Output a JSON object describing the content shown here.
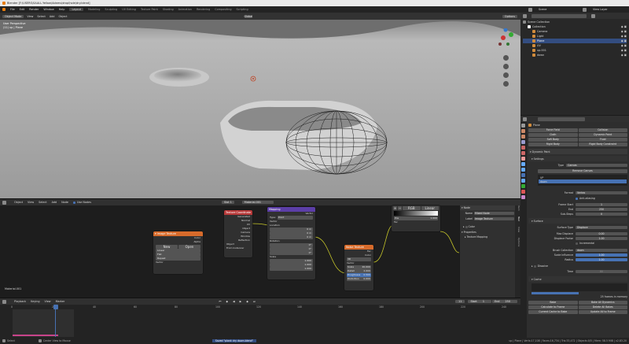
{
  "titlebar": {
    "title": "Blender [F:\\USERS\\SAALL.Yellow\\Adams\\drop\\hole\\dry.blend]"
  },
  "topbar": {
    "menus": [
      "File",
      "Edit",
      "Render",
      "Window",
      "Help"
    ],
    "workspaces": [
      "Layout",
      "Modeling",
      "Sculpting",
      "UV Editing",
      "Texture Paint",
      "Shading",
      "Animation",
      "Rendering",
      "Compositing",
      "Scripting"
    ],
    "scene": "Scene",
    "view_layer": "View Layer"
  },
  "viewport": {
    "mode": "Object Mode",
    "menus": [
      "View",
      "Select",
      "Add",
      "Object"
    ],
    "orientation": "Global",
    "options": "Options",
    "info_line1": "User Perspective",
    "info_line2": "(11) up | Plane"
  },
  "outliner": {
    "title": "Scene Collection",
    "items": [
      {
        "name": "Collection",
        "icon": "collection-icon"
      },
      {
        "name": "Camera",
        "icon": "camera-icon"
      },
      {
        "name": "Light",
        "icon": "light-icon"
      },
      {
        "name": "Plane",
        "icon": "mesh-icon"
      },
      {
        "name": "UV",
        "icon": "mesh-icon"
      },
      {
        "name": "up.001",
        "icon": "mesh-icon"
      },
      {
        "name": "down",
        "icon": "mesh-icon"
      }
    ]
  },
  "physics": {
    "object": "Plane",
    "buttons": [
      "Force Field",
      "Collision",
      "Cloth",
      "Dynamic Paint",
      "Soft Body",
      "Fluid",
      "Rigid Body",
      "Rigid Body Constraint"
    ],
    "dynamic_paint": "Dynamic Paint",
    "settings": "Settings",
    "type_label": "Type",
    "type_value": "Canvas",
    "remove_canvas": "Remove Canvas",
    "surfaces": [
      "UP",
      "down"
    ],
    "format_label": "Format",
    "format_value": "Vertex",
    "anti_aliasing": "Anti-aliasing",
    "frame_start_label": "Frame Start",
    "frame_start": "1",
    "end_label": "End",
    "end": "250",
    "substeps_label": "Sub-Steps",
    "substeps": "0",
    "surface": "Surface",
    "surface_type_label": "Surface Type",
    "surface_type": "Displace",
    "max_disp_label": "Max Displace",
    "max_disp": "0.00",
    "disp_factor_label": "Displace Factor",
    "disp_factor": "1.00",
    "incremental": "Incremental",
    "brush_coll_label": "Brush Collection",
    "brush_coll": "down",
    "scale_influence_label": "Scale Influence",
    "scale_influence": "1.00",
    "radius_label": "Radius",
    "radius": "1.00",
    "dissolve": "Dissolve",
    "time_label": "Time",
    "time": "80",
    "cache": "Cache",
    "cache_info": "25 frames in memory",
    "bake_buttons": [
      "Bake",
      "Calculate to Frame",
      "Current Cache to Bake",
      "Bake All Dynamics",
      "Delete All Bakes",
      "Update All to Frame"
    ]
  },
  "node_editor": {
    "menus": [
      "Object",
      "View",
      "Select",
      "Add",
      "Node"
    ],
    "use_nodes": "Use Nodes",
    "slot": "Slot 1",
    "material": "Material.001",
    "label": "Material.001"
  },
  "nodes": {
    "image_texture": {
      "title": "Image Texture",
      "color": "Color",
      "alpha": "Alpha",
      "new": "New",
      "open": "Open",
      "interp": "Linear",
      "proj": "Flat",
      "ext": "Repeat",
      "vector": "Vector"
    },
    "tex_coord": {
      "title": "Texture Coordinate",
      "outputs": [
        "Generated",
        "Normal",
        "UV",
        "Object",
        "Camera",
        "Window",
        "Reflection"
      ],
      "object_label": "Object",
      "from_instancer": "From Instancer"
    },
    "mapping": {
      "title": "Mapping",
      "vector": "Vector",
      "type_label": "Type:",
      "type": "Point",
      "vec_in": "Vector",
      "location": "Location",
      "rotation": "Rotation",
      "scale": "Scale",
      "loc": [
        "0 m",
        "0 m",
        "0 m"
      ],
      "rot": [
        "0°",
        "0°",
        "0°"
      ],
      "scl": [
        "1.000",
        "1.000",
        "1.000"
      ]
    },
    "noise": {
      "title": "Noise Texture",
      "fac": "Fac",
      "color": "Color",
      "dim": "3D",
      "vector": "Vector",
      "scale_l": "Scale",
      "scale": "20.000",
      "detail_l": "Detail",
      "detail": "2.000",
      "rough_l": "Roughness",
      "rough": "0.500",
      "distort_l": "Distortion",
      "distort": "0.000"
    },
    "ramp": {
      "mode": "RGB",
      "interp": "Linear",
      "pos_label": "Pos",
      "pos": "1.000",
      "fac": "Fac",
      "color": "Color",
      "alpha": "Alpha"
    }
  },
  "sidepanel": {
    "title": "Node",
    "name_label": "Name",
    "name": "Mixed Node",
    "label_label": "Label",
    "image_tex": "Image Texture",
    "color_label": "Color",
    "properties": "Properties",
    "tex_mapping": "Texture Mapping",
    "tabs": [
      "Item",
      "Tool",
      "View",
      "Options"
    ]
  },
  "timeline": {
    "menus": [
      "Playback",
      "Keying",
      "View",
      "Marker"
    ],
    "current": "11",
    "start_label": "Start",
    "start": "1",
    "end_label": "End",
    "end": "250",
    "ticks": [
      "0",
      "20",
      "40",
      "60",
      "80",
      "100",
      "120",
      "140",
      "160",
      "180",
      "200",
      "220",
      "240"
    ]
  },
  "statusbar": {
    "left": "Select",
    "mid": "Center View to Mouse",
    "notice": "Saved \"plank dry down.blend\"",
    "right": "up | Plane | Verts:17,108 | Faces:16,734 | Tris:33,472 | Objects:0/5 | Mem: 58.5 MiB | v2.83.20"
  },
  "colors": {
    "accent": "#4772b3",
    "selected": "#334d80",
    "image_node": "#d76b2b",
    "texcoord_node": "#b83a3a",
    "mapping_node": "#5c3ea7",
    "noise_node": "#d76b2b"
  }
}
